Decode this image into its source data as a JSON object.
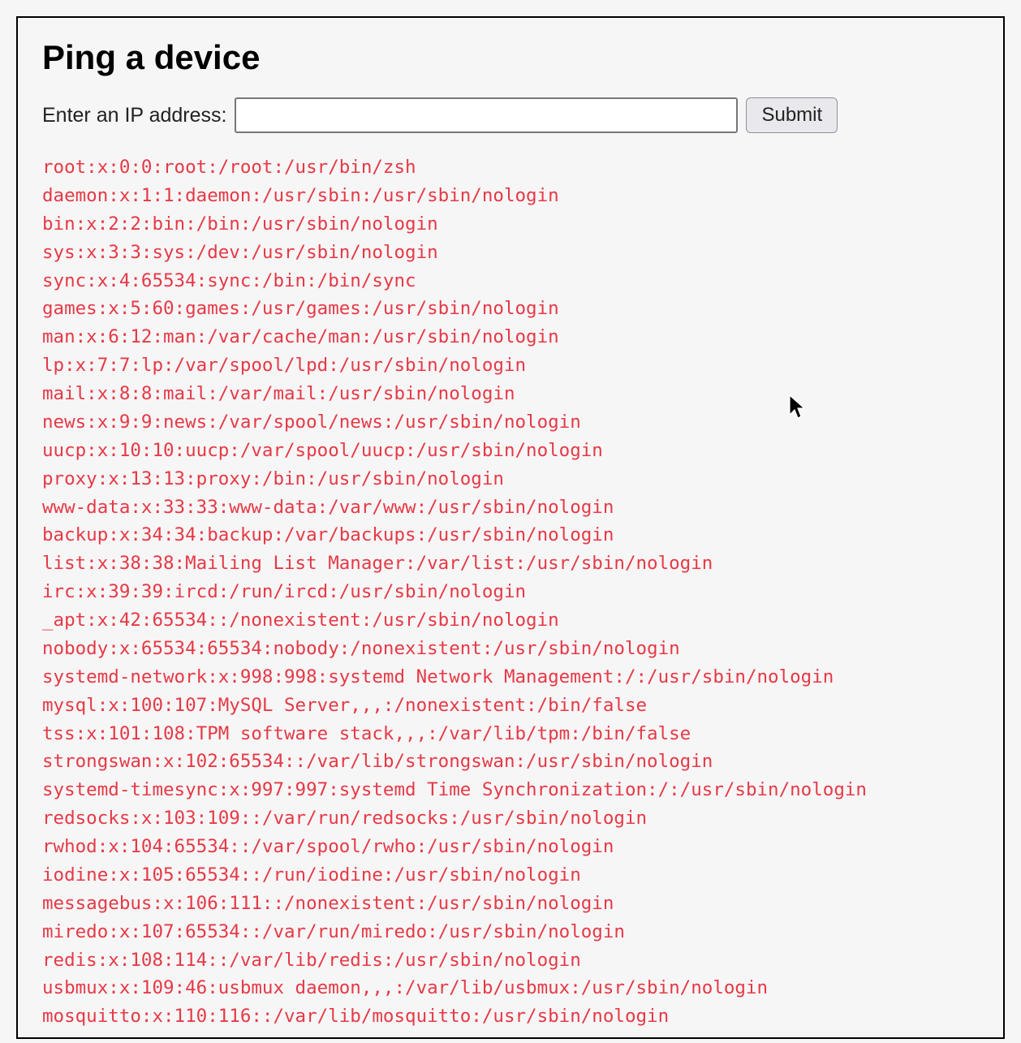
{
  "page": {
    "title": "Ping a device",
    "label": "Enter an IP address:",
    "submit_label": "Submit",
    "ip_value": ""
  },
  "output_lines": [
    "root:x:0:0:root:/root:/usr/bin/zsh",
    "daemon:x:1:1:daemon:/usr/sbin:/usr/sbin/nologin",
    "bin:x:2:2:bin:/bin:/usr/sbin/nologin",
    "sys:x:3:3:sys:/dev:/usr/sbin/nologin",
    "sync:x:4:65534:sync:/bin:/bin/sync",
    "games:x:5:60:games:/usr/games:/usr/sbin/nologin",
    "man:x:6:12:man:/var/cache/man:/usr/sbin/nologin",
    "lp:x:7:7:lp:/var/spool/lpd:/usr/sbin/nologin",
    "mail:x:8:8:mail:/var/mail:/usr/sbin/nologin",
    "news:x:9:9:news:/var/spool/news:/usr/sbin/nologin",
    "uucp:x:10:10:uucp:/var/spool/uucp:/usr/sbin/nologin",
    "proxy:x:13:13:proxy:/bin:/usr/sbin/nologin",
    "www-data:x:33:33:www-data:/var/www:/usr/sbin/nologin",
    "backup:x:34:34:backup:/var/backups:/usr/sbin/nologin",
    "list:x:38:38:Mailing List Manager:/var/list:/usr/sbin/nologin",
    "irc:x:39:39:ircd:/run/ircd:/usr/sbin/nologin",
    "_apt:x:42:65534::/nonexistent:/usr/sbin/nologin",
    "nobody:x:65534:65534:nobody:/nonexistent:/usr/sbin/nologin",
    "systemd-network:x:998:998:systemd Network Management:/:/usr/sbin/nologin",
    "mysql:x:100:107:MySQL Server,,,:/nonexistent:/bin/false",
    "tss:x:101:108:TPM software stack,,,:/var/lib/tpm:/bin/false",
    "strongswan:x:102:65534::/var/lib/strongswan:/usr/sbin/nologin",
    "systemd-timesync:x:997:997:systemd Time Synchronization:/:/usr/sbin/nologin",
    "redsocks:x:103:109::/var/run/redsocks:/usr/sbin/nologin",
    "rwhod:x:104:65534::/var/spool/rwho:/usr/sbin/nologin",
    "iodine:x:105:65534::/run/iodine:/usr/sbin/nologin",
    "messagebus:x:106:111::/nonexistent:/usr/sbin/nologin",
    "miredo:x:107:65534::/var/run/miredo:/usr/sbin/nologin",
    "redis:x:108:114::/var/lib/redis:/usr/sbin/nologin",
    "usbmux:x:109:46:usbmux daemon,,,:/var/lib/usbmux:/usr/sbin/nologin",
    "mosquitto:x:110:116::/var/lib/mosquitto:/usr/sbin/nologin"
  ]
}
